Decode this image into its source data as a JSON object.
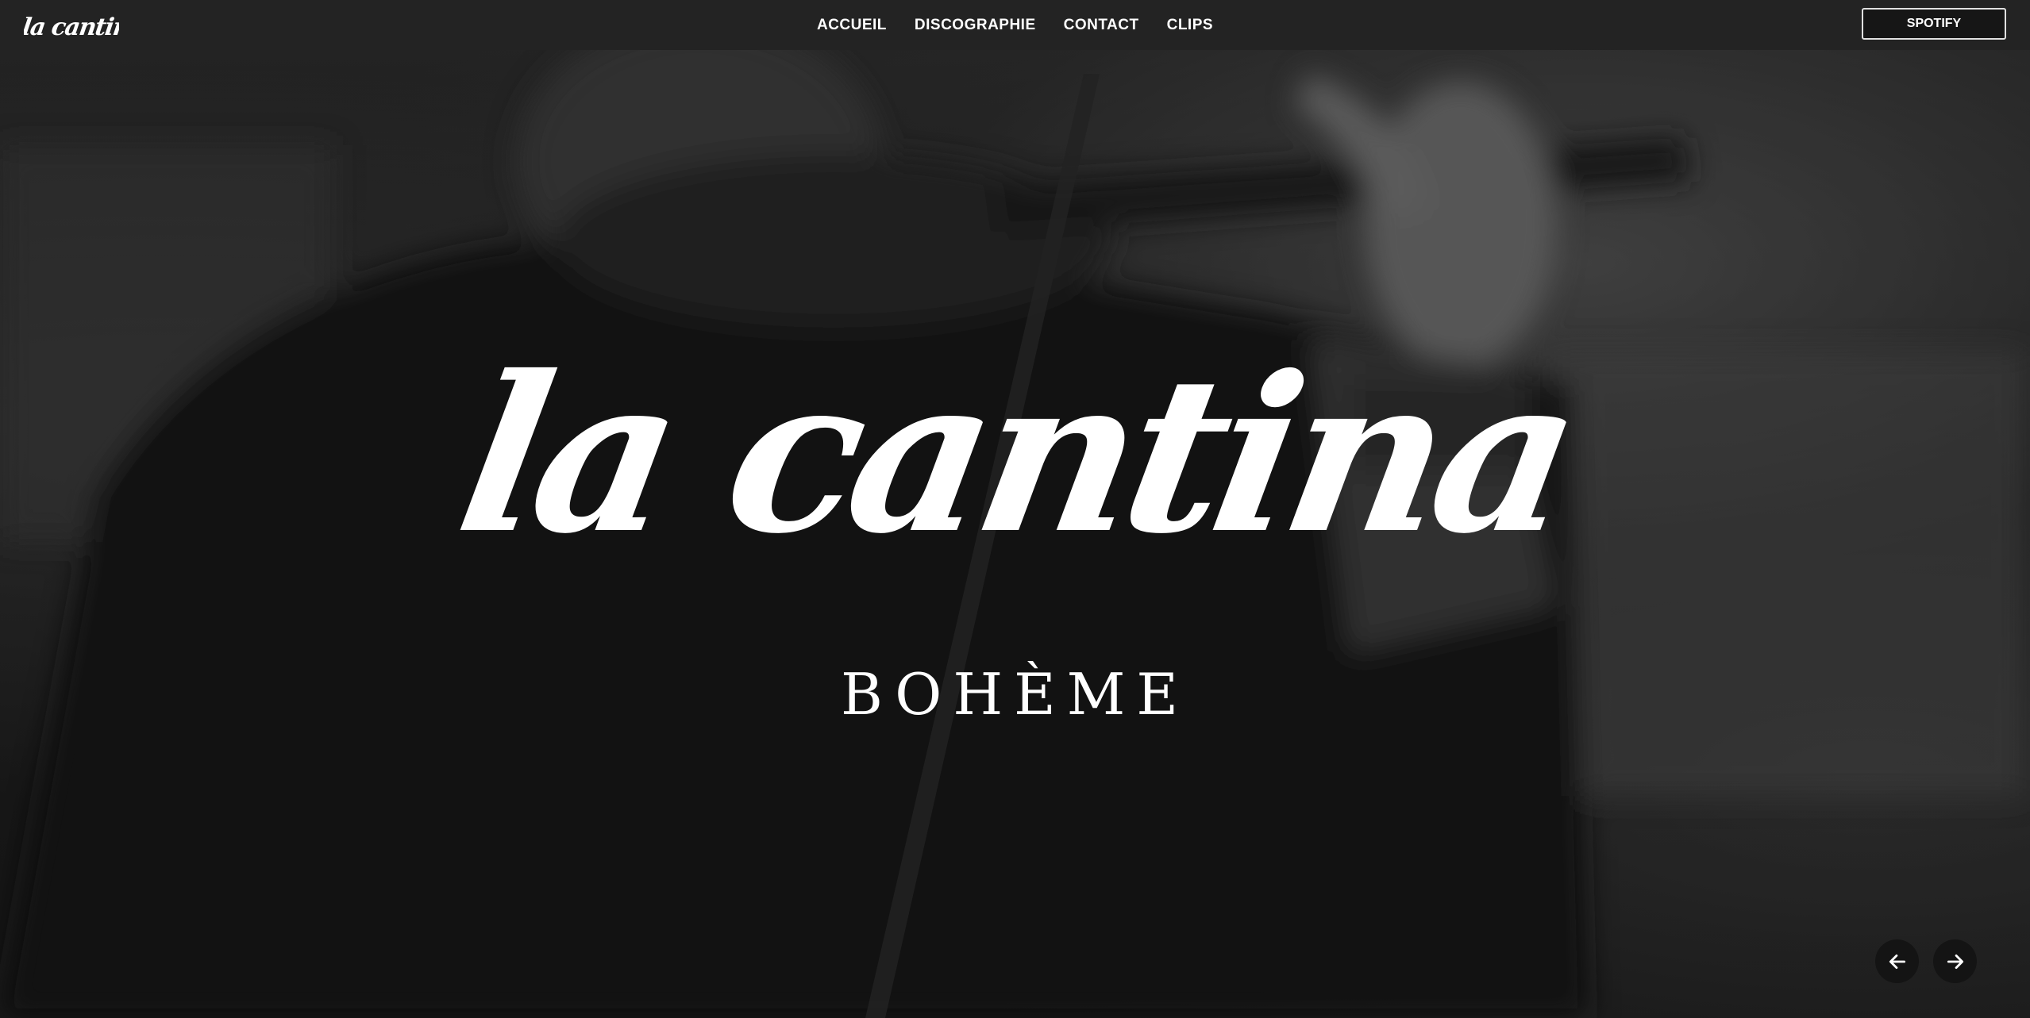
{
  "brand": {
    "logo_text": "la cantina"
  },
  "nav": {
    "items": [
      {
        "label": "ACCUEIL"
      },
      {
        "label": "DISCOGRAPHIE"
      },
      {
        "label": "CONTACT"
      },
      {
        "label": "CLIPS"
      }
    ],
    "spotify_label": "SPOTIFY"
  },
  "hero": {
    "title": "la cantina",
    "subtitle": "BOHÈME",
    "prev_icon": "arrow-left-icon",
    "next_icon": "arrow-right-icon"
  },
  "colors": {
    "navbar_bg": "#232323",
    "text": "#ffffff",
    "arrow_bg": "#141414"
  }
}
